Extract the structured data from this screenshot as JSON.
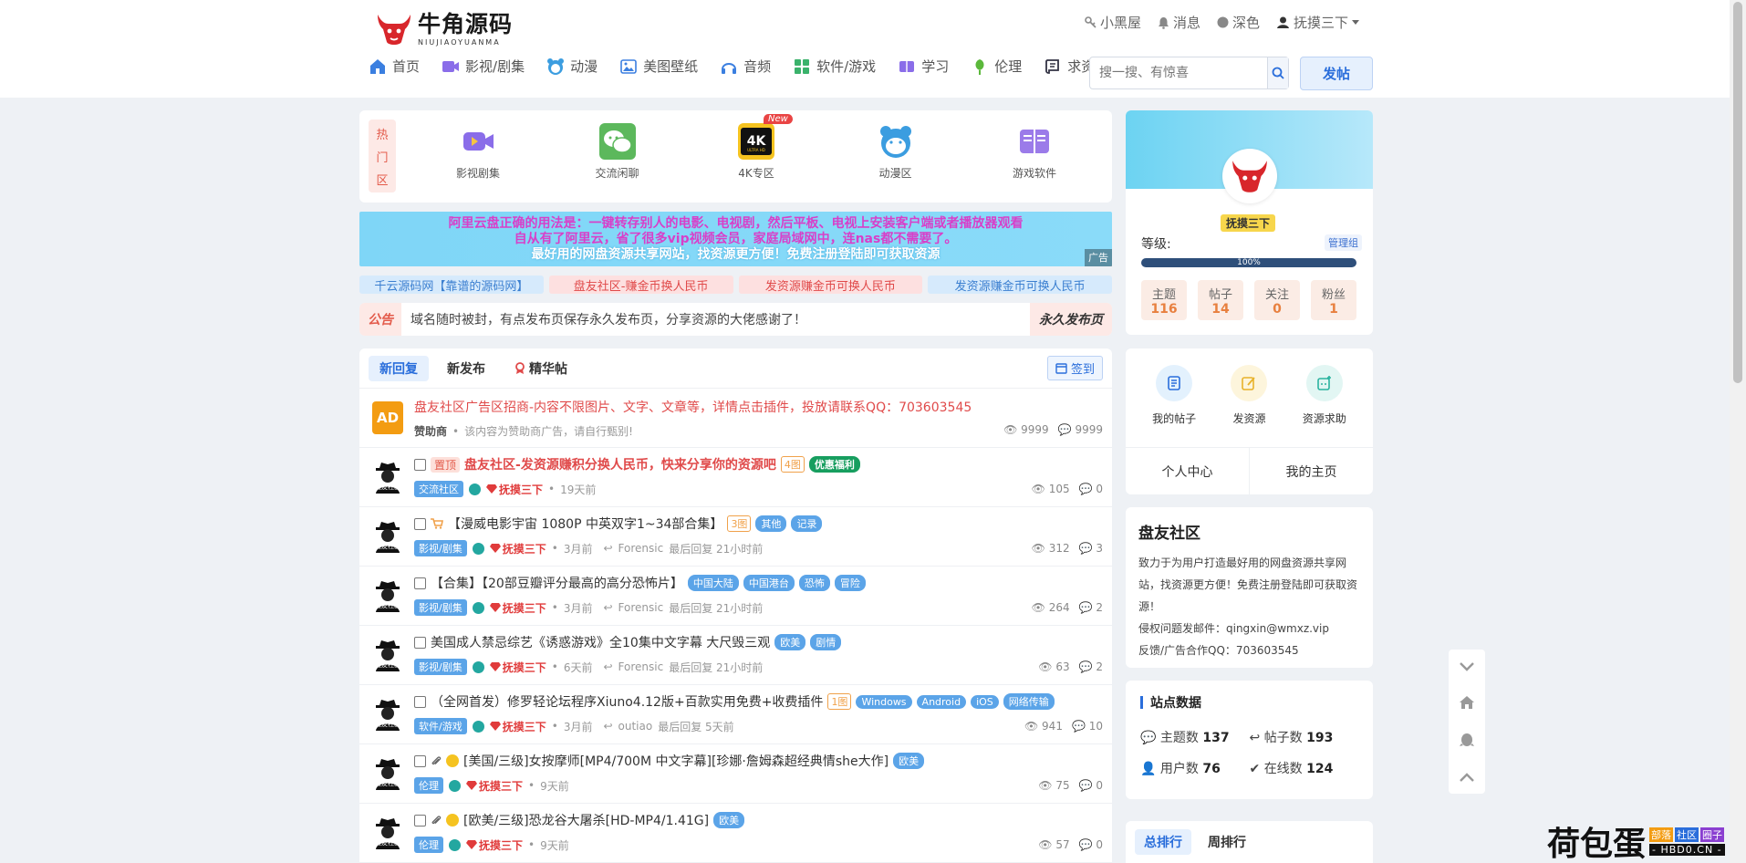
{
  "brand": {
    "name_cn": "牛角源码",
    "name_en": "NIUJIAOYUANMA"
  },
  "top_links": [
    "小黑屋",
    "消息",
    "深色",
    "抚摸三下"
  ],
  "nav": [
    "首页",
    "影视/剧集",
    "动漫",
    "美图壁纸",
    "音频",
    "软件/游戏",
    "学习",
    "伦理",
    "求资源"
  ],
  "search": {
    "placeholder": "搜一搜、有惊喜"
  },
  "post_button": "发帖",
  "hot": {
    "tag": [
      "热",
      "门",
      "区"
    ],
    "items": [
      "影视剧集",
      "交流闲聊",
      "4K专区",
      "动漫区",
      "游戏软件"
    ],
    "new_badge": "New"
  },
  "banner": {
    "line1": "阿里云盘正确的用法是：一键转存别人的电影、电视剧，然后平板、电视上安装客户端或者播放器观看",
    "line2": "自从有了阿里云，省了很多vip视频会员，家庭局域网中，连nas都不需要了。",
    "line3": "最好用的网盘资源共享网站，找资源更方便！免费注册登陆即可获取资源",
    "ad_label": "广告"
  },
  "links": [
    {
      "text": "千云源码网【靠谱的源码网】",
      "bg": "#d6eafc",
      "color": "#3b7fd0"
    },
    {
      "text": "盘友社区-赚金币换人民币",
      "bg": "#fde0e0",
      "color": "#e04a4a"
    },
    {
      "text": "发资源赚金币可换人民币",
      "bg": "#fde0e0",
      "color": "#e04a4a"
    },
    {
      "text": "发资源赚金币可换人民币",
      "bg": "#d6eafc",
      "color": "#3b7fd0"
    }
  ],
  "notice": {
    "label": "公告",
    "text": "域名随时被封，有点发布页保存永久发布页，分享资源的大佬感谢了！",
    "right": "永久发布页"
  },
  "tabs": [
    "新回复",
    "新发布",
    "精华帖"
  ],
  "checkin": "签到",
  "ad_row": {
    "badge": "AD",
    "title": "盘友社区广告区招商-内容不限图片、文字、文章等，详情点击插件，投放请联系QQ：703603545",
    "sponsor": "赞助商",
    "note": "该内容为赞助商广告，请自行甄别!",
    "views": "9999",
    "replies": "9999"
  },
  "threads": [
    {
      "pin": "置顶",
      "title": "盘友社区-发资源赚积分换人民币，快来分享你的资源吧",
      "title_color": "#e04a4a",
      "bold": true,
      "tags_o": [
        "4图"
      ],
      "tags": [],
      "tags_g": [
        "优惠福利"
      ],
      "forum": "交流社区",
      "user": "抚摸三下",
      "time": "19天前",
      "last": "",
      "last_time": "",
      "views": "105",
      "replies": "0"
    },
    {
      "pin": "",
      "icon": "cart",
      "title": "【漫威电影宇宙 1080P 中英双字1~34部合集】",
      "title_color": "#333",
      "tags_o": [
        "3图"
      ],
      "tags": [
        "其他",
        "记录"
      ],
      "tags_g": [],
      "forum": "影视/剧集",
      "user": "抚摸三下",
      "time": "3月前",
      "last": "Forensic",
      "last_time": "最后回复 21小时前",
      "views": "312",
      "replies": "3"
    },
    {
      "pin": "",
      "title": "【合集】【20部豆瓣评分最高的高分恐怖片】",
      "title_color": "#333",
      "tags_o": [],
      "tags": [
        "中国大陆",
        "中国港台",
        "恐怖",
        "冒险"
      ],
      "tags_g": [],
      "forum": "影视/剧集",
      "user": "抚摸三下",
      "time": "3月前",
      "last": "Forensic",
      "last_time": "最后回复 21小时前",
      "views": "264",
      "replies": "2"
    },
    {
      "pin": "",
      "title": "美国成人禁忌综艺《诱惑游戏》全10集中文字幕 大尺毁三观",
      "title_color": "#333",
      "tags_o": [],
      "tags": [
        "欧美",
        "剧情"
      ],
      "tags_g": [],
      "forum": "影视/剧集",
      "user": "抚摸三下",
      "time": "6天前",
      "last": "Forensic",
      "last_time": "最后回复 21小时前",
      "views": "63",
      "replies": "2"
    },
    {
      "pin": "",
      "title": "（全网首发）修罗轻论坛程序Xiuno4.12版+百款实用免费+收费插件",
      "title_color": "#333",
      "tags_o": [
        "1图"
      ],
      "tags": [
        "Windows",
        "Android",
        "iOS",
        "网络传输"
      ],
      "tags_g": [],
      "forum": "软件/游戏",
      "user": "抚摸三下",
      "time": "3月前",
      "last": "outiao",
      "last_time": "最后回复 5天前",
      "views": "941",
      "replies": "10"
    },
    {
      "pin": "",
      "icon": "coin",
      "title": "[美国/三级]女按摩师[MP4/700M 中文字幕][珍娜·詹姆森超经典情she大作]",
      "title_color": "#333",
      "tags_o": [],
      "tags": [
        "欧美"
      ],
      "tags_g": [],
      "forum": "伦理",
      "user": "抚摸三下",
      "time": "9天前",
      "last": "",
      "last_time": "",
      "views": "75",
      "replies": "0"
    },
    {
      "pin": "",
      "icon": "coin",
      "title": "[欧美/三级]恐龙谷大屠杀[HD-MP4/1.41G]",
      "title_color": "#333",
      "tags_o": [],
      "tags": [
        "欧美"
      ],
      "tags_g": [],
      "forum": "伦理",
      "user": "抚摸三下",
      "time": "9天前",
      "last": "",
      "last_time": "",
      "views": "57",
      "replies": "0"
    }
  ],
  "profile": {
    "name": "抚摸三下",
    "level_label": "等级:",
    "group": "管理组",
    "progress": "100%",
    "stats": [
      {
        "label": "主题",
        "value": "116"
      },
      {
        "label": "帖子",
        "value": "14"
      },
      {
        "label": "关注",
        "value": "0"
      },
      {
        "label": "粉丝",
        "value": "1"
      }
    ]
  },
  "actions": {
    "items": [
      "我的帖子",
      "发资源",
      "资源求助"
    ],
    "links": [
      "个人中心",
      "我的主页"
    ]
  },
  "about": {
    "title": "盘友社区",
    "desc": "致力于为用户打造最好用的网盘资源共享网站，找资源更方便！免费注册登陆即可获取资源！",
    "email": "侵权问题发邮件：qingxin@wmxz.vip",
    "qq": "反馈/广告合作QQ：703603545"
  },
  "site_stats": {
    "title": "站点数据",
    "items": [
      {
        "label": "主题数",
        "value": "137"
      },
      {
        "label": "帖子数",
        "value": "193"
      },
      {
        "label": "用户数",
        "value": "76"
      },
      {
        "label": "在线数",
        "value": "124"
      }
    ]
  },
  "rank_tabs": [
    "总排行",
    "周排行"
  ],
  "watermark": {
    "main": "荷包蛋",
    "tags": [
      "部落",
      "社区",
      "圈子"
    ],
    "domain": "- HBD0.CN -"
  }
}
